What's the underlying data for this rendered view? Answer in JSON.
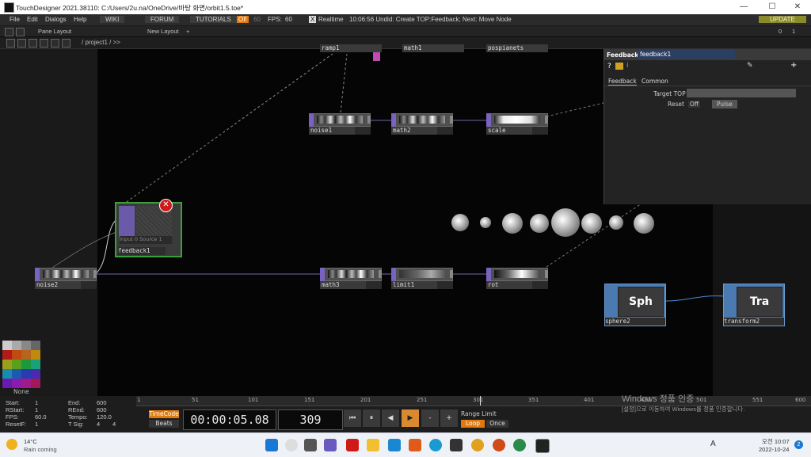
{
  "window": {
    "title": "TouchDesigner 2021.38110: C:/Users/2u.na/OneDrive/바탕 화면/orbit1.5.toe*",
    "minimize": "—",
    "maximize": "☐",
    "close": "✕"
  },
  "menu": {
    "items": [
      "File",
      "Edit",
      "Dialogs",
      "Help"
    ],
    "wiki": "WIKI",
    "forum": "FORUM",
    "tutorials": "TUTORIALS",
    "oi": "OI!",
    "oi_num": "60",
    "fps_label": "FPS:",
    "fps_value": "60",
    "realtime_x": "X",
    "realtime": "Realtime",
    "undo": "10:06:56 Undid: Create TOP:Feedback; Next: Move Node",
    "update": "UPDATE"
  },
  "panebar": {
    "pane_layout": "Pane Layout",
    "new_layout": "New Layout",
    "plus": "+",
    "zero": "0",
    "one": "1"
  },
  "pathbar": {
    "path": "/ project1 / >>"
  },
  "nodes": {
    "ramp1": "ramp1",
    "math1": "math1",
    "pospianets": "pospianets",
    "noise1": "noise1",
    "math2": "math2",
    "scale": "scale",
    "feedback1": "feedback1",
    "feedback1_error": "Input 0 Source 1",
    "noise2": "noise2",
    "math3": "math3",
    "limit1": "limit1",
    "rot": "rot",
    "sphere2": "sphere2",
    "sphere2_short": "Sph",
    "transform2": "transform2",
    "transform2_short": "Tra"
  },
  "params": {
    "op_type": "Feedback",
    "op_name": "feedback1",
    "tab_feedback": "Feedback",
    "tab_common": "Common",
    "target_label": "Target TOP",
    "reset_label": "Reset",
    "reset_value": "Off",
    "pulse": "Pulse"
  },
  "palette": {
    "none": "None",
    "colors": [
      "#cccccc",
      "#aaaaaa",
      "#888888",
      "#666666",
      "#b31a1a",
      "#c04a10",
      "#b5651d",
      "#c08a10",
      "#9aa01a",
      "#5aa01a",
      "#1a9a3a",
      "#1aa07a",
      "#1a8ab0",
      "#1a5ab0",
      "#2a3ab0",
      "#4a2ab0",
      "#6a1ab0",
      "#8a1ab0",
      "#a01a8a",
      "#a01a5a"
    ]
  },
  "timeline": {
    "ruler": [
      "1",
      "51",
      "101",
      "151",
      "201",
      "251",
      "301",
      "351",
      "401",
      "451",
      "501",
      "551",
      "600"
    ],
    "start_label": "Start:",
    "start": "1",
    "end_label": "End:",
    "end": "600",
    "rstart_label": "RStart:",
    "rstart": "1",
    "rend_label": "REnd:",
    "rend": "600",
    "fps_label": "FPS:",
    "fps": "60.0",
    "tempo_label": "Tempo:",
    "tempo": "120.0",
    "resetf_label": "ResetF:",
    "resetf": "1",
    "tsig_label": "T Sig:",
    "tsig_a": "4",
    "tsig_b": "4",
    "timecode": "TimeCode",
    "beats": "Beats",
    "time": "00:00:05.08",
    "frame": "309",
    "range_limit": "Range Limit",
    "loop": "Loop",
    "once": "Once",
    "btn_start": "⏮",
    "btn_pause": "⏸",
    "btn_back": "◀",
    "btn_play": "▶",
    "btn_minus": "-",
    "btn_plus": "+"
  },
  "watermark": {
    "line1": "Windows 정품 인증",
    "line2": "[설정]으로 이동하여 Windows를 정품 인증합니다."
  },
  "taskbar": {
    "temp": "14°C",
    "weather": "Rain coming",
    "ampm": "오전 10:07",
    "date": "2022-10-24",
    "notif": "2",
    "ime": "A"
  }
}
